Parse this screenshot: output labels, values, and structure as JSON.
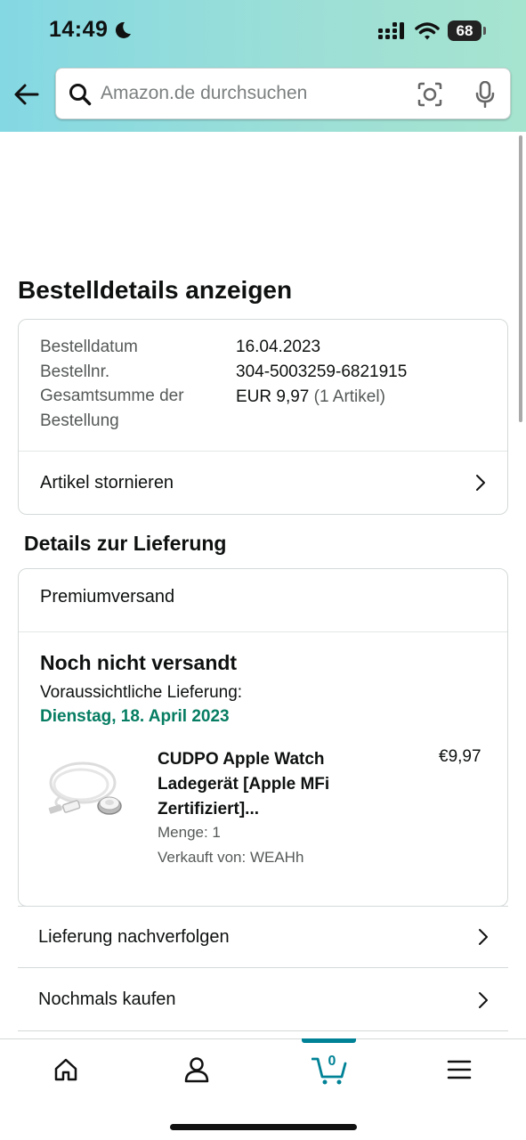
{
  "status_bar": {
    "time": "14:49",
    "battery": "68"
  },
  "search": {
    "placeholder": "Amazon.de durchsuchen"
  },
  "page": {
    "title": "Bestelldetails anzeigen"
  },
  "order_summary": {
    "rows": [
      {
        "label": "Bestelldatum",
        "value": "16.04.2023"
      },
      {
        "label": "Bestellnr.",
        "value": "304-5003259-6821915"
      },
      {
        "label": "Gesamtsumme der Bestellung",
        "value": "EUR 9,97",
        "extra": "(1 Artikel)"
      }
    ],
    "cancel_label": "Artikel stornieren"
  },
  "delivery": {
    "section_title": "Details zur Lieferung",
    "method": "Premiumversand",
    "status": "Noch nicht versandt",
    "eta_label": "Voraussichtliche Lieferung:",
    "eta_date": "Dienstag, 18. April 2023",
    "eta_color": "#067d62",
    "product": {
      "name": "CUDPO Apple Watch Ladegerät [Apple MFi Zertifiziert]...",
      "price": "€9,97",
      "quantity": "Menge: 1",
      "seller": "Verkauft von: WEAHh"
    }
  },
  "actions": {
    "track": "Lieferung nachverfolgen",
    "buy_again": "Nochmals kaufen"
  },
  "bottom_nav": {
    "cart_count": "0",
    "accent": "#008296",
    "items": [
      "home-icon",
      "account-icon",
      "cart-icon",
      "menu-icon"
    ]
  }
}
